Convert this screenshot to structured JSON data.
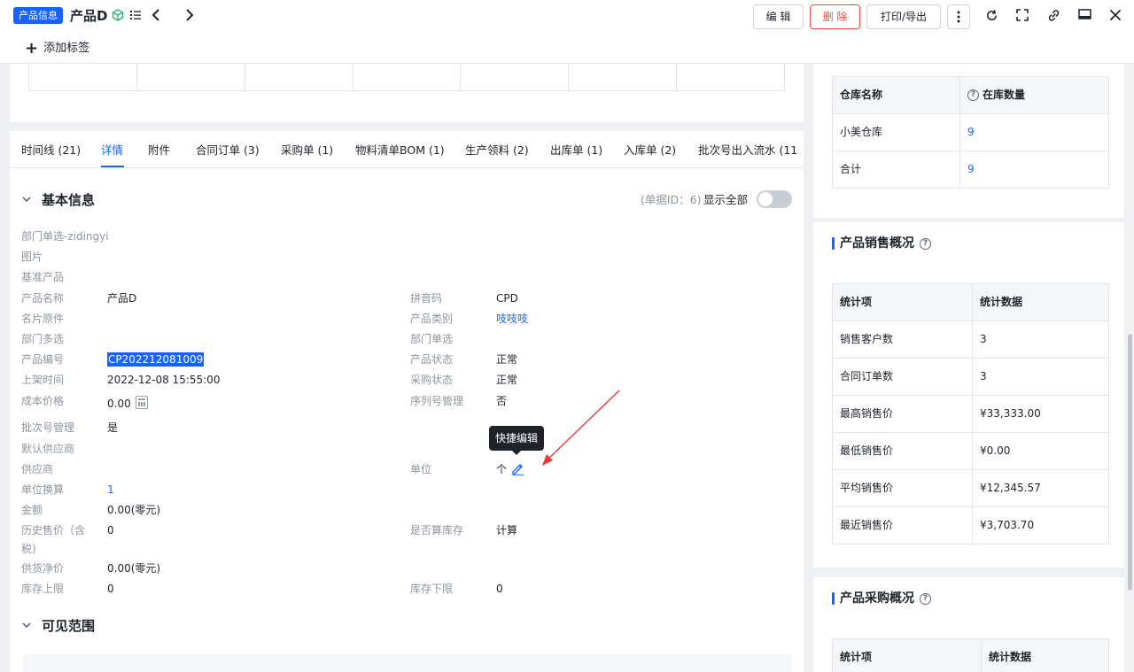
{
  "header": {
    "badge": "产品信息",
    "title": "产品D",
    "buttons": {
      "edit": "编 辑",
      "delete": "删 除",
      "print": "打印/导出"
    },
    "add_tag": "添加标签"
  },
  "tabs": [
    {
      "label": "时间线 (21)"
    },
    {
      "label": "详情"
    },
    {
      "label": "附件"
    },
    {
      "label": "合同订单 (3)"
    },
    {
      "label": "采购单 (1)"
    },
    {
      "label": "物料清单BOM (1)"
    },
    {
      "label": "生产领料 (2)"
    },
    {
      "label": "出库单 (1)"
    },
    {
      "label": "入库单 (2)"
    },
    {
      "label": "批次号出入流水 (11"
    }
  ],
  "basic": {
    "title": "基本信息",
    "doc_id": "(单据ID：6)",
    "show_all": "显示全部",
    "fields": {
      "dept_single": "部门单选-zidingyi",
      "image": "图片",
      "base_product": "基准产品",
      "product_name": {
        "label": "产品名称",
        "value": "产品D"
      },
      "pinyin": {
        "label": "拼音码",
        "value": "CPD"
      },
      "card_part": "名片原件",
      "category": {
        "label": "产品类别",
        "value": "吱吱吱"
      },
      "dept_multi": "部门多选",
      "dept_multi_r": "部门单选",
      "product_no": {
        "label": "产品编号",
        "value": "CP202212081009"
      },
      "status": {
        "label": "产品状态",
        "value": "正常"
      },
      "listing_time": {
        "label": "上架时间",
        "value": "2022-12-08 15:55:00"
      },
      "purchase_status": {
        "label": "采购状态",
        "value": "正常"
      },
      "cost_price": {
        "label": "成本价格",
        "value": "0.00"
      },
      "serial_mgmt": {
        "label": "序列号管理",
        "value": "否"
      },
      "batch_mgmt": {
        "label": "批次号管理",
        "value": "是"
      },
      "default_supplier": "默认供应商",
      "supplier": "供应商",
      "unit": {
        "label": "单位",
        "value": "个"
      },
      "unit_conv": {
        "label": "单位换算",
        "value": "1"
      },
      "amount": {
        "label": "金额",
        "value": "0.00(零元)"
      },
      "hist_price": {
        "label1": "历史售价（含",
        "label2": "税)",
        "value": "0"
      },
      "count_stock": {
        "label": "是否算库存",
        "value": "计算"
      },
      "supply_net": {
        "label": "供货净价",
        "value": "0.00(零元)"
      },
      "stock_upper": {
        "label": "库存上限",
        "value": "0"
      },
      "stock_lower": {
        "label": "库存下限",
        "value": "0"
      }
    },
    "tooltip": "快捷编辑"
  },
  "visible_scope": {
    "title": "可见范围"
  },
  "warehouse": {
    "headers": [
      "仓库名称",
      "在库数量"
    ],
    "rows": [
      {
        "name": "小美仓库",
        "qty": "9"
      },
      {
        "name": "合计",
        "qty": "9"
      }
    ]
  },
  "sales_overview": {
    "title": "产品销售概况",
    "headers": [
      "统计项",
      "统计数据"
    ],
    "rows": [
      {
        "item": "销售客户数",
        "value": "3"
      },
      {
        "item": "合同订单数",
        "value": "3"
      },
      {
        "item": "最高销售价",
        "value": "¥33,333.00"
      },
      {
        "item": "最低销售价",
        "value": "¥0.00"
      },
      {
        "item": "平均销售价",
        "value": "¥12,345.57"
      },
      {
        "item": "最近销售价",
        "value": "¥3,703.70"
      }
    ]
  },
  "purchase_overview": {
    "title": "产品采购概况",
    "headers": [
      "统计项",
      "统计数据"
    ]
  },
  "colors": {
    "primary": "#1664ff",
    "danger": "#f54a45",
    "arrow": "#e53935"
  }
}
